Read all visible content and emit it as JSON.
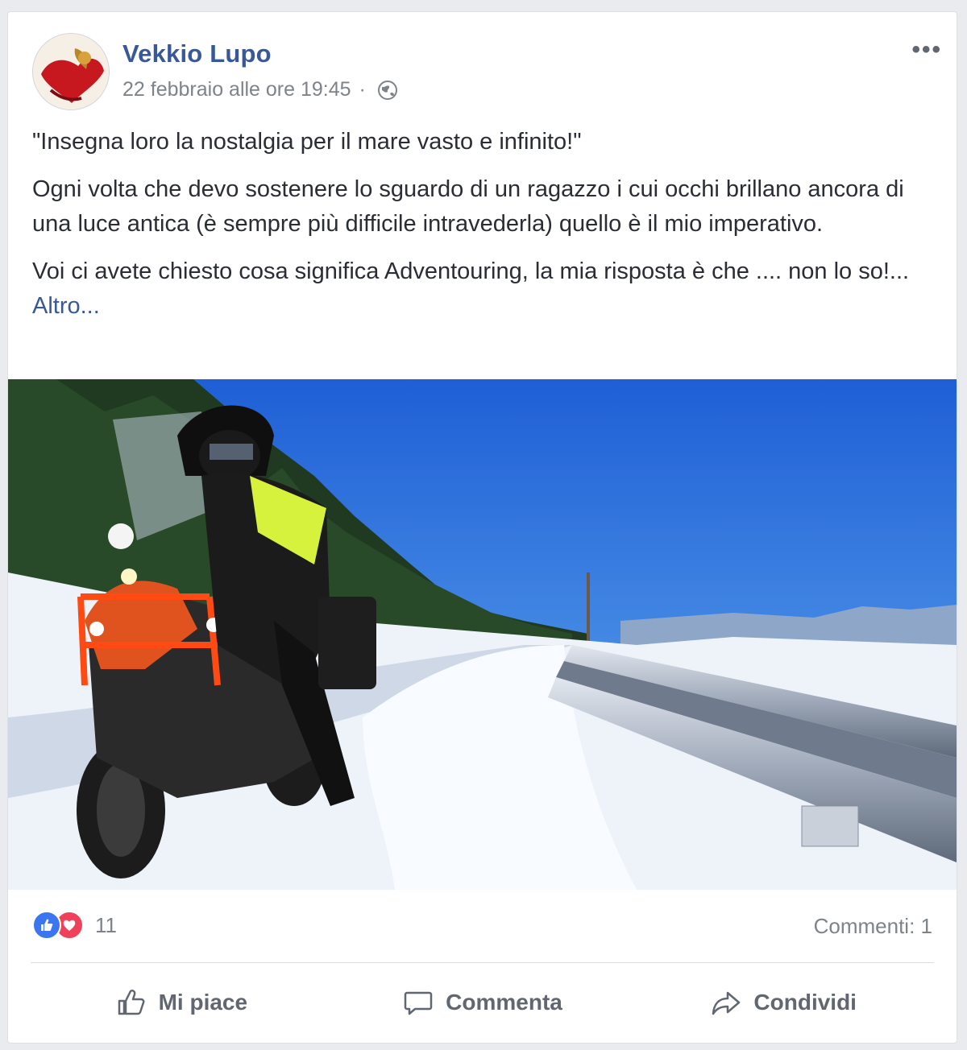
{
  "post": {
    "author": "Vekkio Lupo",
    "date": "22 febbraio alle ore 19:45",
    "separator": "·",
    "privacy_icon": "globe-icon",
    "more_label": "•••",
    "quote": "\"Insegna loro la nostalgia per il mare vasto e infinito!\"",
    "paragraph1": "Ogni volta che devo sostenere lo sguardo di un ragazzo i cui occhi brillano ancora di una luce antica (è sempre più difficile intravederla) quello è il mio imperativo.",
    "paragraph2": "Voi ci avete chiesto cosa significa Adventouring, la mia risposta è che .... non lo so!...",
    "see_more": "Altro...",
    "photo_icon": "motorcycle-snow-photo"
  },
  "reactions": {
    "icons": [
      "like-icon",
      "love-icon"
    ],
    "count": "11",
    "comments": "Commenti: 1"
  },
  "actions": {
    "like": "Mi piace",
    "comment": "Commenta",
    "share": "Condividi"
  },
  "colors": {
    "author_link": "#385898",
    "like_blue": "#3b76f0",
    "love_red": "#f0415b",
    "sky_blue": "#2f6fd8"
  }
}
